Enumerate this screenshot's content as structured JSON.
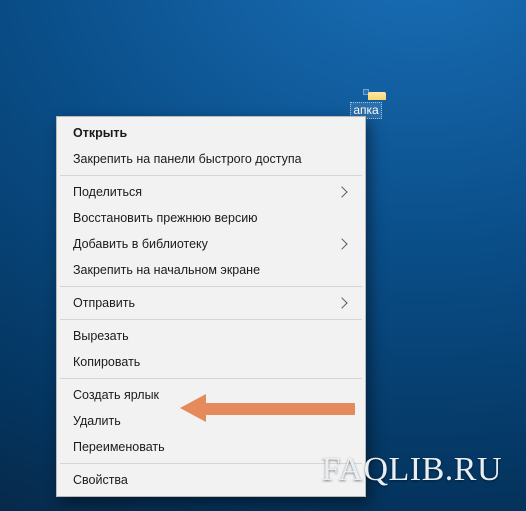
{
  "desktop": {
    "folder_label": "апка"
  },
  "context_menu": {
    "open": "Открыть",
    "pin_quick_access": "Закрепить на панели быстрого доступа",
    "share": "Поделиться",
    "restore_previous": "Восстановить прежнюю версию",
    "add_to_library": "Добавить в библиотеку",
    "pin_start": "Закрепить на начальном экране",
    "send_to": "Отправить",
    "cut": "Вырезать",
    "copy": "Копировать",
    "create_shortcut": "Создать ярлык",
    "delete": "Удалить",
    "rename": "Переименовать",
    "properties": "Свойства"
  },
  "watermark": "FAQLIB.RU"
}
